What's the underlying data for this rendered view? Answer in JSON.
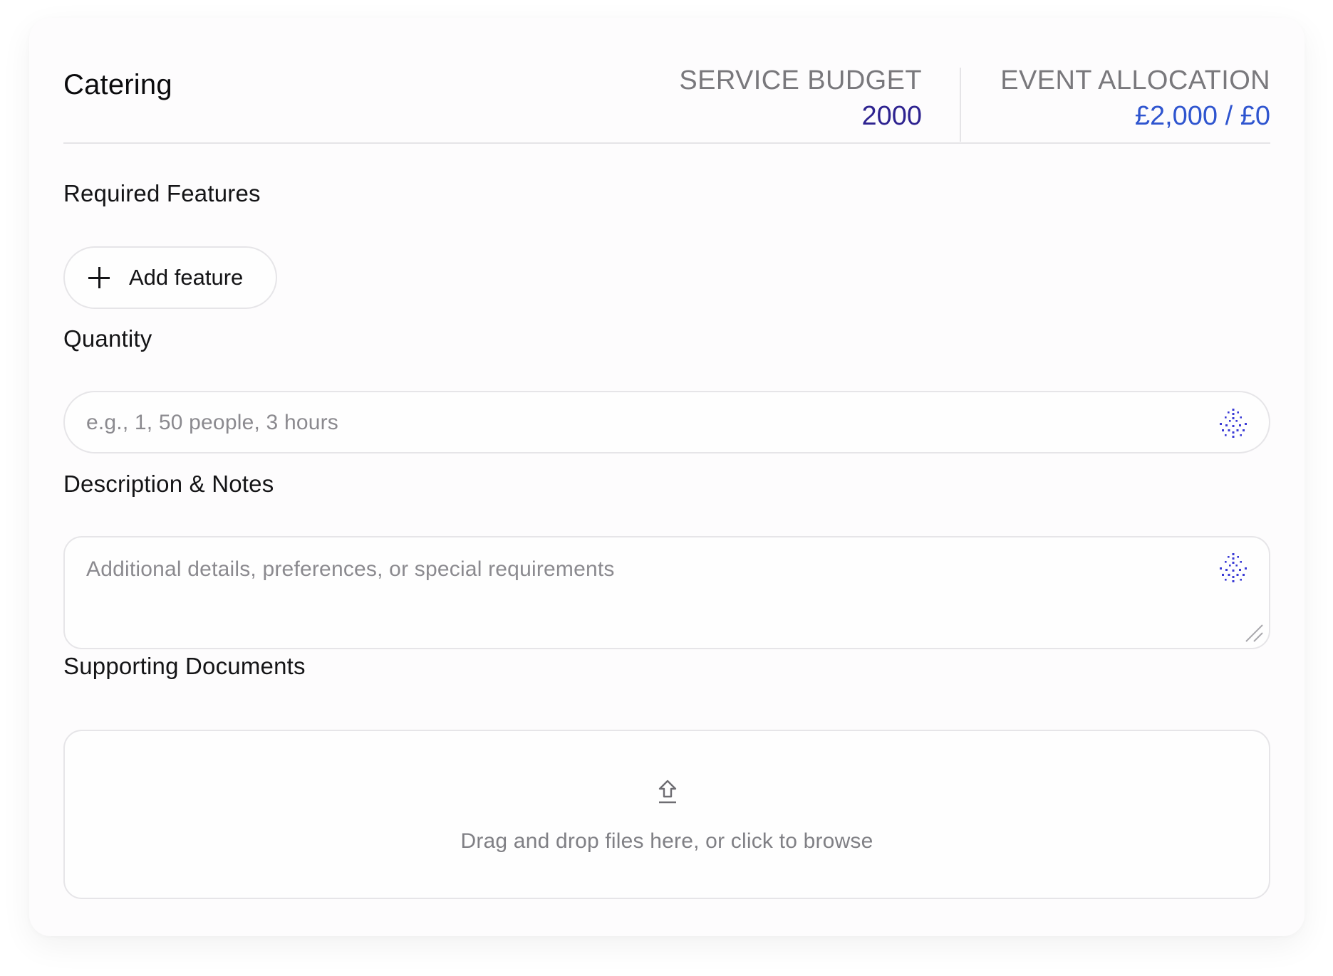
{
  "header": {
    "title": "Catering",
    "service_budget": {
      "label": "SERVICE BUDGET",
      "value": "2000"
    },
    "event_allocation": {
      "label": "EVENT ALLOCATION",
      "value": "£2,000 / £0"
    }
  },
  "required_features": {
    "label": "Required Features",
    "add_button_label": "Add feature",
    "icon": "plus-icon"
  },
  "quantity": {
    "label": "Quantity",
    "placeholder": "e.g., 1, 50 people, 3 hours",
    "value": "",
    "icon": "sparkle-dots-icon"
  },
  "description": {
    "label": "Description & Notes",
    "placeholder": "Additional details, preferences, or special requirements",
    "value": "",
    "icon": "sparkle-dots-icon"
  },
  "documents": {
    "label": "Supporting Documents",
    "dropzone_text": "Drag and drop files here, or click to browse",
    "icon": "upload-icon"
  },
  "colors": {
    "budget_value": "#2e2390",
    "allocation_value": "#2f55cf",
    "ai_icon": "#3b3bd6"
  }
}
